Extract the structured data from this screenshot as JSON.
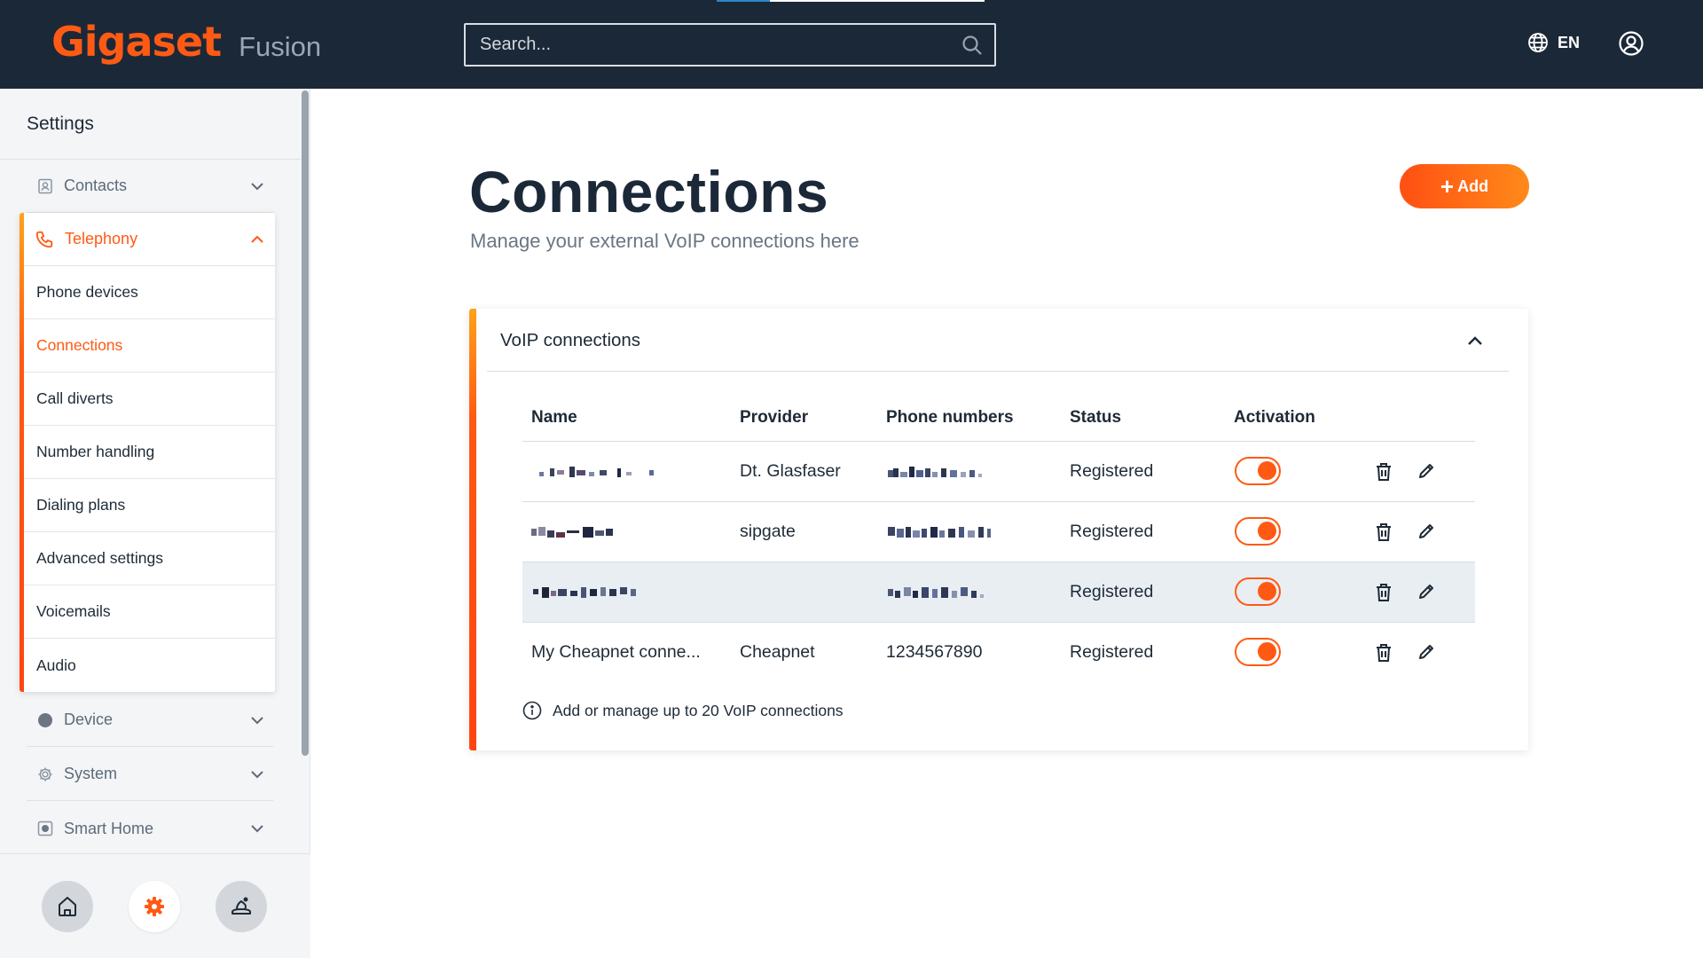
{
  "header": {
    "logo": "Gigaset",
    "product": "Fusion",
    "search_placeholder": "Search...",
    "language": "EN"
  },
  "sidebar": {
    "title": "Settings",
    "items_top": [
      {
        "label": "Contacts",
        "icon": "contacts-icon"
      }
    ],
    "telephony": {
      "label": "Telephony",
      "icon": "phone-icon",
      "expanded": true,
      "subitems": [
        {
          "label": "Phone devices"
        },
        {
          "label": "Connections",
          "active": true
        },
        {
          "label": "Call diverts"
        },
        {
          "label": "Number handling"
        },
        {
          "label": "Dialing plans"
        },
        {
          "label": "Advanced settings"
        },
        {
          "label": "Voicemails"
        },
        {
          "label": "Audio"
        }
      ]
    },
    "items_bottom": [
      {
        "label": "Device",
        "icon": "device-icon"
      },
      {
        "label": "System",
        "icon": "gear-icon"
      },
      {
        "label": "Smart Home",
        "icon": "smart-home-icon"
      }
    ],
    "footer_buttons": [
      "home-icon",
      "settings-icon",
      "assistant-icon"
    ]
  },
  "main": {
    "title": "Connections",
    "subtitle": "Manage your external VoIP connections here",
    "add_label": "Add"
  },
  "card": {
    "title": "VoIP connections",
    "columns": [
      "Name",
      "Provider",
      "Phone numbers",
      "Status",
      "Activation"
    ],
    "rows": [
      {
        "name": "",
        "name_redacted": true,
        "provider": "Dt. Glasfaser",
        "phone_numbers": "",
        "numbers_redacted": true,
        "status": "Registered",
        "active": true
      },
      {
        "name": "",
        "name_redacted": true,
        "provider": "sipgate",
        "phone_numbers": "",
        "numbers_redacted": true,
        "status": "Registered",
        "active": true
      },
      {
        "name": "",
        "name_redacted": true,
        "provider": "",
        "phone_numbers": "",
        "numbers_redacted": true,
        "status": "Registered",
        "active": true,
        "highlighted": true
      },
      {
        "name": "My Cheapnet conne...",
        "provider": "Cheapnet",
        "phone_numbers": "1234567890",
        "status": "Registered",
        "active": true
      }
    ],
    "hint": "Add or manage up to 20 VoIP connections"
  },
  "colors": {
    "topbar": "#1b2838",
    "accent": "#ff5a14",
    "sidebar_bg": "#f3f5f7",
    "row_highlight": "#e9eef3"
  }
}
